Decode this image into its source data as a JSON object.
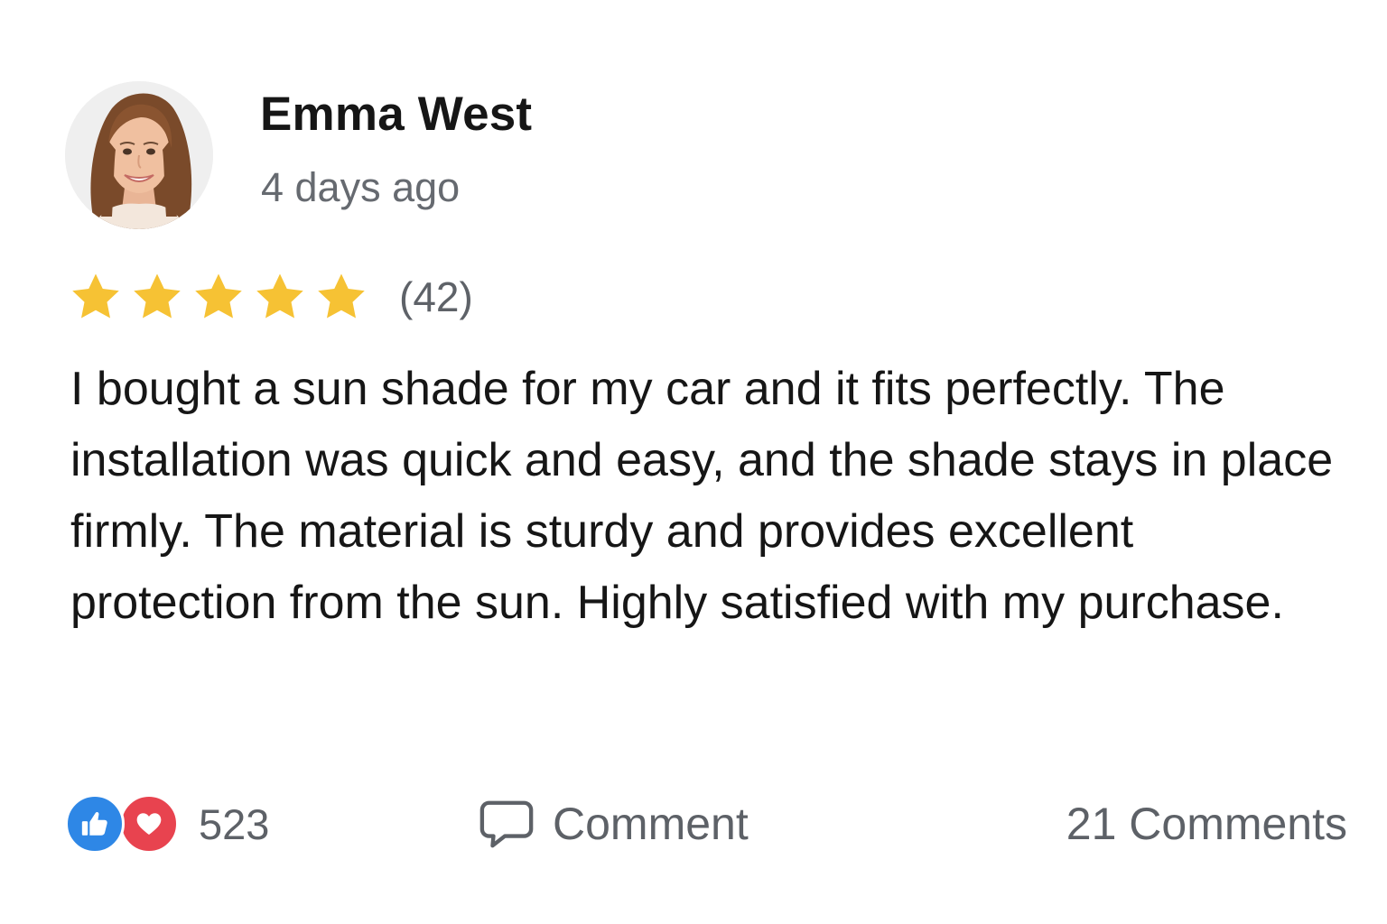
{
  "review": {
    "user": {
      "name": "Emma West",
      "avatar": "avatar-photo-woman"
    },
    "timestamp": "4 days ago",
    "rating": {
      "stars": 5,
      "max_stars": 5,
      "star_color": "#f6c234",
      "count": "(42)"
    },
    "body": "I bought a sun shade for my car and it fits perfectly. The installation was quick and easy, and the shade stays in place firmly. The material is sturdy and provides excellent protection from the sun. Highly satisfied with my purchase."
  },
  "footer": {
    "reactions": {
      "icons": [
        "thumbs-up-icon",
        "heart-icon"
      ],
      "like_color": "#2e87e6",
      "love_color": "#e8434f",
      "count": "523"
    },
    "comment_button": {
      "icon": "comment-bubble-icon",
      "label": "Comment"
    },
    "comments_count": "21 Comments"
  }
}
